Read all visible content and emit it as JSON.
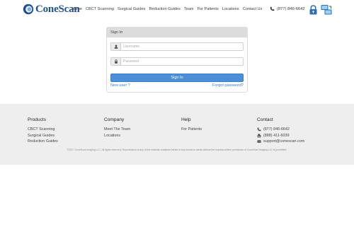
{
  "brand": {
    "name": "ConeScan",
    "color": "#1d4f91"
  },
  "nav": [
    "Home",
    "CBCT Scanning",
    "Surgical Guides",
    "Reduction Guides",
    "Team",
    "For Patients",
    "Locations",
    "Contact Us"
  ],
  "header": {
    "phone": "(877) 846-6642",
    "lock_icon": "lock-icon",
    "remote_icon": "remote-desktop-icon"
  },
  "signin": {
    "title": "Sign In",
    "username_placeholder": "Username",
    "password_placeholder": "Password",
    "button": "Sign In",
    "new_user": "New user ?",
    "forgot": "Forgot password?"
  },
  "footer": {
    "products": {
      "title": "Products",
      "links": [
        "CBCT Scanning",
        "Surgical Guides",
        "Reduction Guides"
      ]
    },
    "company": {
      "title": "Company",
      "links": [
        "Meet The Team",
        "Locations"
      ]
    },
    "help": {
      "title": "Help",
      "links": [
        "For Patients"
      ]
    },
    "contact": {
      "title": "Contact",
      "phone": "(877) 846-6642",
      "fax": "(888) 411-6039",
      "email": "support@conescan.com"
    },
    "copyright": "©2017 ConeScan Imaging LLC. All rights reserved. Reproduction of any of the material contained herein in any format or media without the express written permission of ConeScan Imaging LLC is prohibited."
  },
  "colors": {
    "accent": "#4a8fd8",
    "link": "#3b7dc4",
    "footer_bg": "#eeeeee",
    "panel_head": "#dcdcdc"
  }
}
